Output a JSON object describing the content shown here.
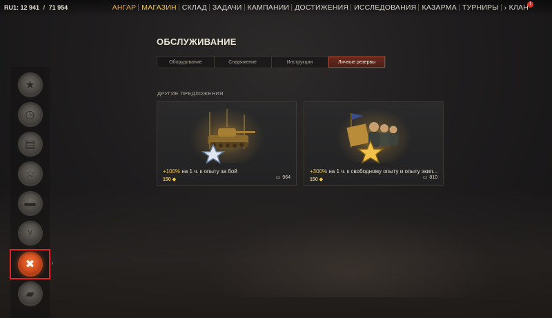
{
  "header": {
    "server": "RU1:",
    "players_server": "12 941",
    "separator": "/",
    "players_total": "71 954"
  },
  "nav": {
    "items": [
      {
        "label": "АНГАР",
        "state": "home"
      },
      {
        "label": "МАГАЗИН",
        "state": "active"
      },
      {
        "label": "СКЛАД",
        "state": ""
      },
      {
        "label": "ЗАДАЧИ",
        "state": ""
      },
      {
        "label": "КАМПАНИИ",
        "state": ""
      },
      {
        "label": "ДОСТИЖЕНИЯ",
        "state": ""
      },
      {
        "label": "ИССЛЕДОВАНИЯ",
        "state": ""
      },
      {
        "label": "КАЗАРМА",
        "state": ""
      },
      {
        "label": "ТУРНИРЫ",
        "state": ""
      }
    ],
    "clan_label": "КЛАН",
    "clan_arrow": "›",
    "clan_badge": "!"
  },
  "sidebar": {
    "items": [
      {
        "icon": "star-icon",
        "glyph": "★"
      },
      {
        "icon": "clock-icon",
        "glyph": "◷"
      },
      {
        "icon": "money-icon",
        "glyph": "▤"
      },
      {
        "icon": "star-wreath-icon",
        "glyph": "☆"
      },
      {
        "icon": "tank-icon",
        "glyph": "▬"
      },
      {
        "icon": "brush-icon",
        "glyph": "♆"
      },
      {
        "icon": "wrench-screwdriver-icon",
        "glyph": "✖",
        "active": true
      },
      {
        "icon": "gold-bar-icon",
        "glyph": "▰"
      }
    ],
    "expand_arrow": "›"
  },
  "main": {
    "title": "ОБСЛУЖИВАНИЕ",
    "tabs": [
      {
        "label": "Оборудование",
        "active": false
      },
      {
        "label": "Снаряжение",
        "active": false
      },
      {
        "label": "Инструкции",
        "active": false
      },
      {
        "label": "Личные резервы",
        "active": true
      }
    ],
    "section_label": "ДРУГИЕ ПРЕДЛОЖЕНИЯ",
    "cards": [
      {
        "pct": "+100%",
        "text": " на 1 ч. к опыту за бой",
        "price": "150",
        "owned": "964",
        "art": "tank-reserve-icon"
      },
      {
        "pct": "+300%",
        "text": " на 1 ч. к свободному опыту и опыту экип...",
        "price": "150",
        "owned": "810",
        "art": "crew-reserve-icon"
      }
    ]
  },
  "colors": {
    "accent_gold": "#f0c64c",
    "home_orange": "#e8a437",
    "active_red": "#cf4b1d",
    "highlight_outline": "#e22222"
  }
}
